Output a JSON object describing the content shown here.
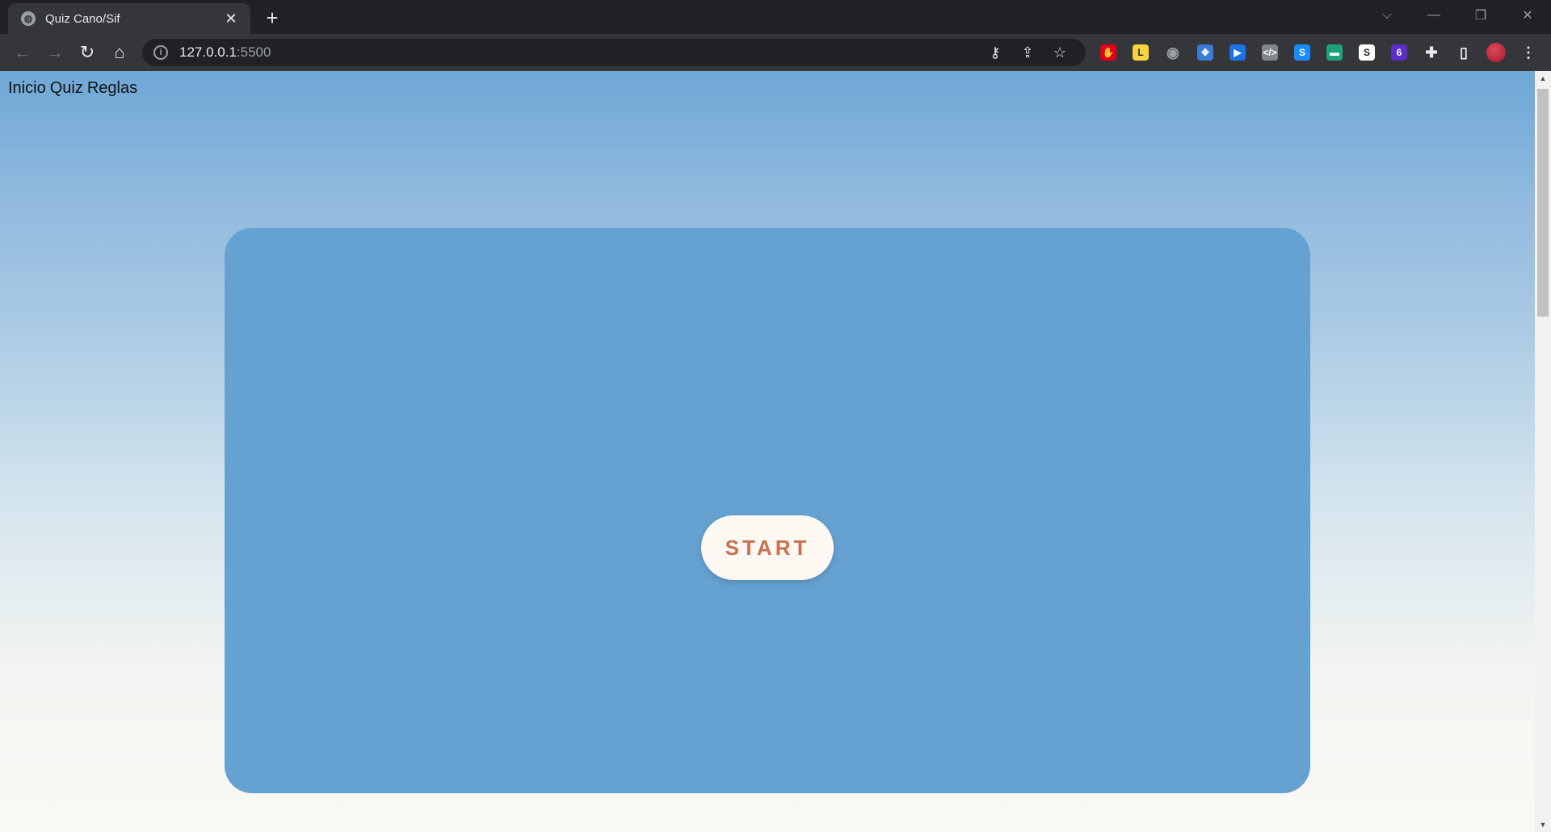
{
  "browser": {
    "tab_title": "Quiz Cano/Sif",
    "tab_close": "✕",
    "new_tab": "+",
    "url_host": "127.0.0.1",
    "url_port": ":5500",
    "window_controls": [
      "⌵",
      "—",
      "❐",
      "✕"
    ]
  },
  "nav": {
    "back": "←",
    "forward": "→",
    "reload": "↻",
    "home": "⌂"
  },
  "extensions": [
    {
      "name": "adblock-icon",
      "color": "#e0001b",
      "glyph": "✋"
    },
    {
      "name": "extension-l-icon",
      "color": "#f7d43c",
      "glyph": "L"
    },
    {
      "name": "camera-icon",
      "color": "#9aa0a6",
      "glyph": "◉"
    },
    {
      "name": "extension-grid-icon",
      "color": "#3a7bd5",
      "glyph": "✥"
    },
    {
      "name": "extension-play-icon",
      "color": "#1a73e8",
      "glyph": "▶"
    },
    {
      "name": "code-icon",
      "color": "#80868b",
      "glyph": "</>"
    },
    {
      "name": "shazam-icon",
      "color": "#1a8cff",
      "glyph": "S"
    },
    {
      "name": "extension-card-icon",
      "color": "#1aa37a",
      "glyph": "▬"
    },
    {
      "name": "extension-s-icon",
      "color": "#ffffff",
      "glyph": "S"
    },
    {
      "name": "extension-badge-icon",
      "color": "#5b2ec9",
      "glyph": "6"
    },
    {
      "name": "puzzle-icon",
      "color": "#e8eaed",
      "glyph": "✚"
    },
    {
      "name": "sidepanel-icon",
      "color": "#e8eaed",
      "glyph": "▯"
    },
    {
      "name": "avatar",
      "color": "#b3263a",
      "glyph": ""
    },
    {
      "name": "menu-icon",
      "color": "#e8eaed",
      "glyph": "⋮"
    }
  ],
  "page": {
    "nav_links": [
      "Inicio",
      "Quiz",
      "Reglas"
    ],
    "start_label": "START"
  }
}
